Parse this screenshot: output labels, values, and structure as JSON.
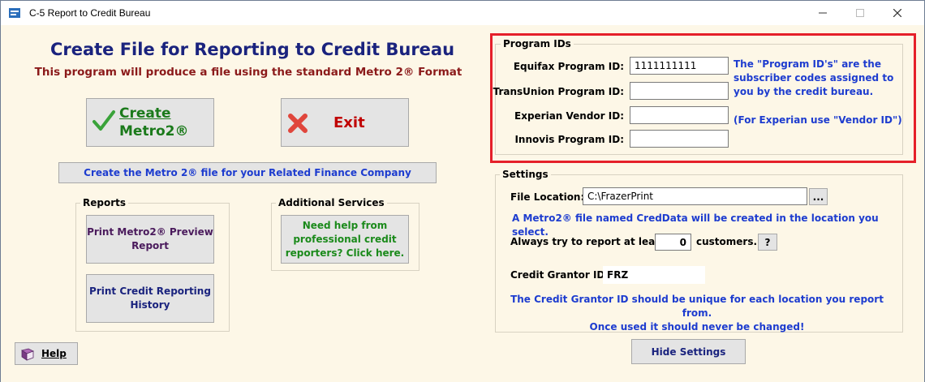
{
  "window": {
    "title": "C-5  Report to Credit Bureau",
    "minimize_glyph": "—",
    "maximize_glyph": "☐",
    "close_glyph": "✕"
  },
  "header": {
    "title": "Create File for Reporting to Credit Bureau",
    "subtitle": "This program will produce a file using the standard Metro 2® Format"
  },
  "actions": {
    "create_line1": "Create",
    "create_line2": "Metro2®",
    "exit_label": "Exit",
    "related_finance_label": "Create the Metro 2®  file for your Related Finance Company"
  },
  "reports": {
    "group_label": "Reports",
    "preview_label": "Print Metro2® Preview Report",
    "history_label": "Print Credit Reporting History"
  },
  "additional_services": {
    "group_label": "Additional Services",
    "help_label": "Need help from professional credit reporters?  Click here."
  },
  "help": {
    "label": "Help"
  },
  "program_ids": {
    "group_label": "Program IDs",
    "equifax_label": "Equifax Program ID:",
    "equifax_value": "1111111111",
    "transunion_label": "TransUnion Program ID:",
    "transunion_value": "",
    "experian_label": "Experian Vendor ID:",
    "experian_value": "",
    "innovis_label": "Innovis Program ID:",
    "innovis_value": "",
    "note_line1": "The \"Program ID's\" are the",
    "note_line2": "subscriber codes assigned to",
    "note_line3": "you by the credit bureau.",
    "experian_note": "(For Experian use \"Vendor ID\")"
  },
  "settings": {
    "group_label": "Settings",
    "file_location_label": "File Location:",
    "file_location_value": "C:\\FrazerPrint",
    "browse_label": "...",
    "location_note": "A Metro2® file named CredData will be created in the location you select.",
    "always_report_label": "Always try to report at least",
    "min_customers_value": "0",
    "customers_label": "customers.",
    "question_label": "?",
    "grantor_label": "Credit Grantor ID:",
    "grantor_value": "FRZ",
    "grantor_note_line1": "The Credit Grantor ID should be unique for each location you report from.",
    "grantor_note_line2": "Once used it should never be changed!",
    "hide_label": "Hide Settings"
  },
  "colors": {
    "background": "#fdf7e7",
    "title_blue": "#1a237e",
    "subtitle_red": "#8b1a1a",
    "note_blue": "#1d3ccf",
    "highlight_red": "#e5202a"
  }
}
